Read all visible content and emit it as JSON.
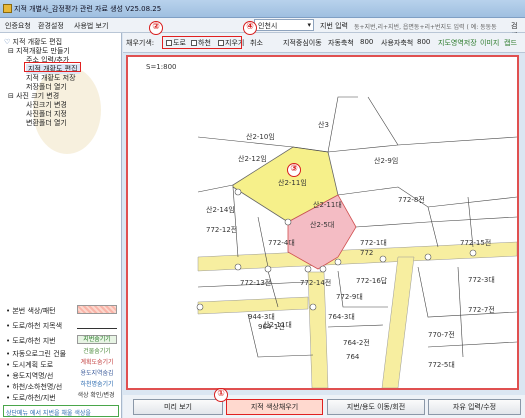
{
  "window": {
    "title": "지적 개별사_감정평가 관련 자료 생성 V25.08.25"
  },
  "menubar": {
    "items": [
      "인증요청",
      "환경설정",
      "사용법 보기"
    ],
    "region_select": "인천시",
    "address_label": "지번 입력",
    "address_placeholder": "동+지번,리+지번, 읍면동+리+번지도 입력 ( 예: 동동동",
    "search_label": "검 색"
  },
  "sidebar": {
    "tree": [
      {
        "label": "지적 개황도 편집",
        "level": 0
      },
      {
        "label": "지적개황도 만들기",
        "level": 1
      },
      {
        "label": "주소 입력/추가",
        "level": 2
      },
      {
        "label": "지적 개황도 편집",
        "level": 2,
        "selected": true
      },
      {
        "label": "지적 개황도 저장",
        "level": 2
      },
      {
        "label": "저장폴더 열기",
        "level": 2
      },
      {
        "label": "사진 크기 변경",
        "level": 1
      },
      {
        "label": "사진크기 변경",
        "level": 2
      },
      {
        "label": "사진폴더 지정",
        "level": 2
      },
      {
        "label": "변환폴더 열기",
        "level": 2
      }
    ],
    "legend": [
      {
        "label": "• 본번 색상/패턴",
        "swatch": ""
      },
      {
        "label": "• 도로/하천 지목색",
        "swatch": ""
      },
      {
        "label": "• 도로/하천 지번",
        "swatch": "지번숨기기"
      },
      {
        "label": "• 자동으로그린 건물",
        "swatch": "건물숨기기"
      },
      {
        "label": "• 도시계획 도로",
        "swatch": "계획도숨기기"
      },
      {
        "label": "• 용도지역명/선",
        "swatch": "용도지역숨김"
      },
      {
        "label": "• 하천/소하천명/선",
        "swatch": "하천명숨기기"
      },
      {
        "label": "• 도로/하천/지번",
        "swatch": "색상 확인/변경"
      }
    ],
    "hint": "상단메뉴 에서 지번을 채울 색상을"
  },
  "toolbar": {
    "fill_label": "채우기색:",
    "checks": [
      "도로",
      "하천",
      "지우기"
    ],
    "cancel": "취소",
    "center_label": "지적중심이동",
    "auto_scale_label": "자동축척",
    "auto_scale_value": "800",
    "user_scale_label": "사용자축척",
    "user_scale_value": "800",
    "zone_save": "지도영역저장",
    "image_label": "이미지",
    "capture_label": "캡드"
  },
  "map": {
    "scale": "S=1:800",
    "parcels": [
      "산3",
      "산2-10임",
      "산2-11임",
      "산2-9임",
      "산2-12임",
      "산2-14임",
      "772-8전",
      "772-12전",
      "772-4대",
      "772-1대",
      "772-15전",
      "772-13전",
      "772-14전",
      "772-16답",
      "772-9대",
      "772-3대",
      "772-7전",
      "944-3대",
      "764-3대",
      "770-7전",
      "764-2전",
      "964-1전",
      "산2-11대",
      "산2-5대",
      "산2-11대",
      "772",
      "764",
      "772-5대"
    ]
  },
  "bottombar": {
    "buttons": [
      "미리 보기",
      "지적 색상채우기",
      "지번/용도 이동/회전",
      "자유 입력/수정"
    ]
  },
  "annotations": [
    "①",
    "②",
    "③",
    "④"
  ],
  "colors": {
    "accent_red": "#e02020",
    "road_yellow": "#f7eea0",
    "parcel_yellow": "#f6f08a",
    "parcel_pink": "#f4bcc4"
  }
}
